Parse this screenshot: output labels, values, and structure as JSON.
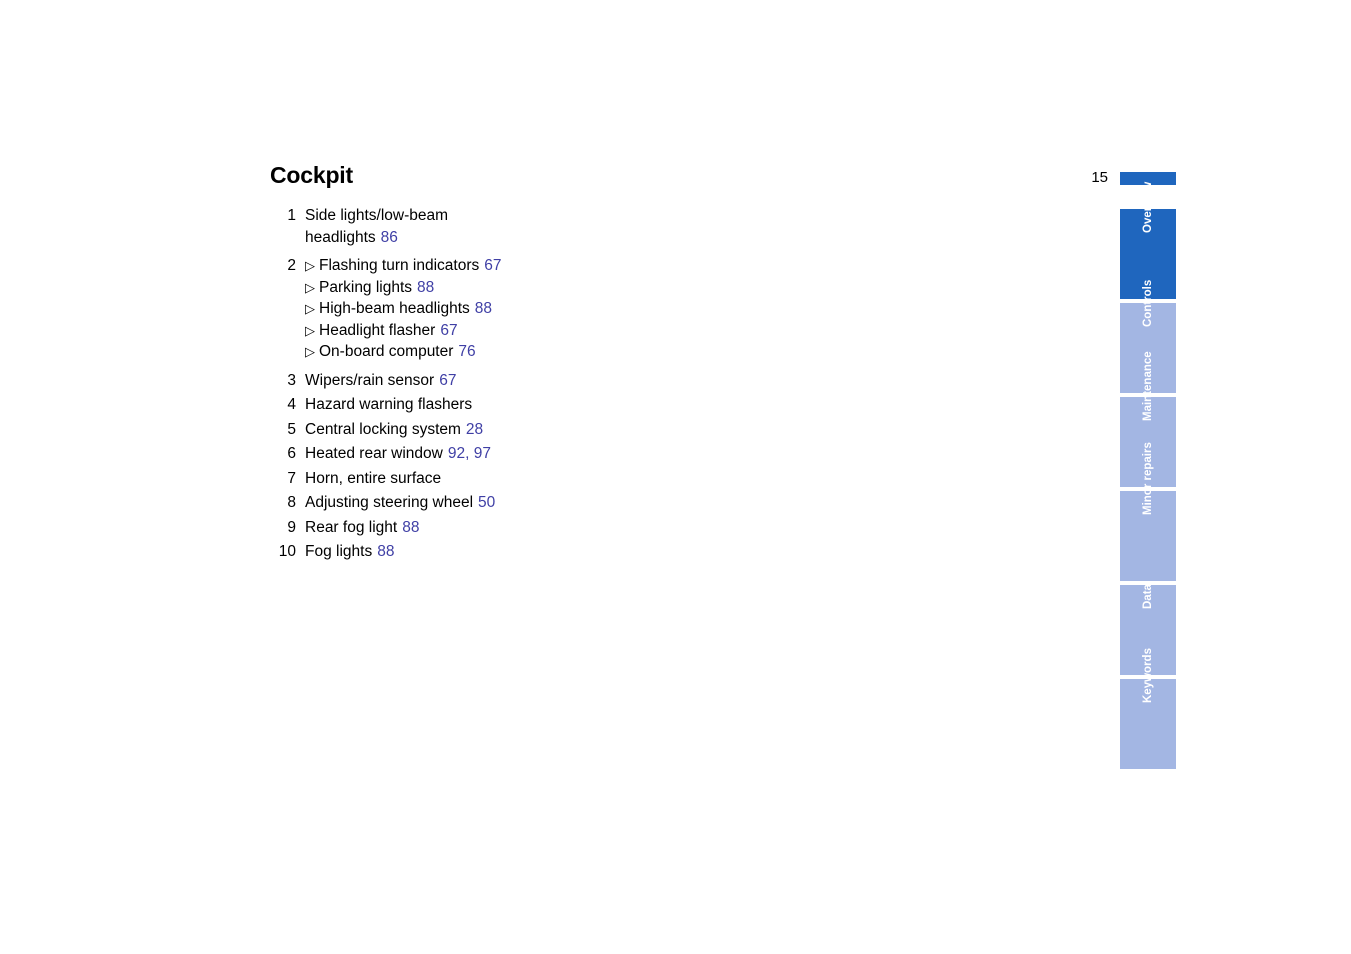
{
  "page": {
    "title": "Cockpit",
    "folio_number": "15",
    "accent_color": "#1F66BE",
    "tab_inactive_color": "#A3B6E3",
    "reference_color": "#3F3FA5",
    "background_color": "#FFFFFF"
  },
  "legend": {
    "bullet_glyph": "▷",
    "items": [
      {
        "number": "1",
        "lines": [
          {
            "bullet": "",
            "label": "Side lights/low-beam",
            "ref": ""
          },
          {
            "bullet": "",
            "label": "headlights",
            "ref": "86"
          }
        ]
      },
      {
        "number": "2",
        "lines": [
          {
            "bullet": "▷",
            "label": "Flashing turn indicators",
            "ref": "67"
          },
          {
            "bullet": "▷",
            "label": "Parking lights",
            "ref": "88"
          },
          {
            "bullet": "▷",
            "label": "High-beam headlights",
            "ref": "88"
          },
          {
            "bullet": "▷",
            "label": "Headlight flasher",
            "ref": "67"
          },
          {
            "bullet": "▷",
            "label": "On-board computer",
            "ref": "76"
          }
        ]
      },
      {
        "number": "3",
        "lines": [
          {
            "bullet": "",
            "label": "Wipers/rain sensor",
            "ref": "67"
          }
        ]
      },
      {
        "number": "4",
        "lines": [
          {
            "bullet": "",
            "label": "Hazard warning flashers",
            "ref": ""
          }
        ]
      },
      {
        "number": "5",
        "lines": [
          {
            "bullet": "",
            "label": "Central locking system",
            "ref": "28"
          }
        ]
      },
      {
        "number": "6",
        "lines": [
          {
            "bullet": "",
            "label": "Heated rear window",
            "ref": "92, 97"
          }
        ]
      },
      {
        "number": "7",
        "lines": [
          {
            "bullet": "",
            "label": "Horn, entire surface",
            "ref": ""
          }
        ]
      },
      {
        "number": "8",
        "lines": [
          {
            "bullet": "",
            "label": "Adjusting steering wheel",
            "ref": "50"
          }
        ]
      },
      {
        "number": "9",
        "lines": [
          {
            "bullet": "",
            "label": "Rear fog light",
            "ref": "88"
          }
        ]
      },
      {
        "number": "10",
        "lines": [
          {
            "bullet": "",
            "label": "Fog lights",
            "ref": "88"
          }
        ]
      }
    ]
  },
  "tabs": [
    {
      "label": "Overview",
      "active": true
    },
    {
      "label": "Controls",
      "active": false
    },
    {
      "label": "Maintenance",
      "active": false
    },
    {
      "label": "Minor repairs",
      "active": false
    },
    {
      "label": "Data",
      "active": false
    },
    {
      "label": "Keywords",
      "active": false
    }
  ]
}
